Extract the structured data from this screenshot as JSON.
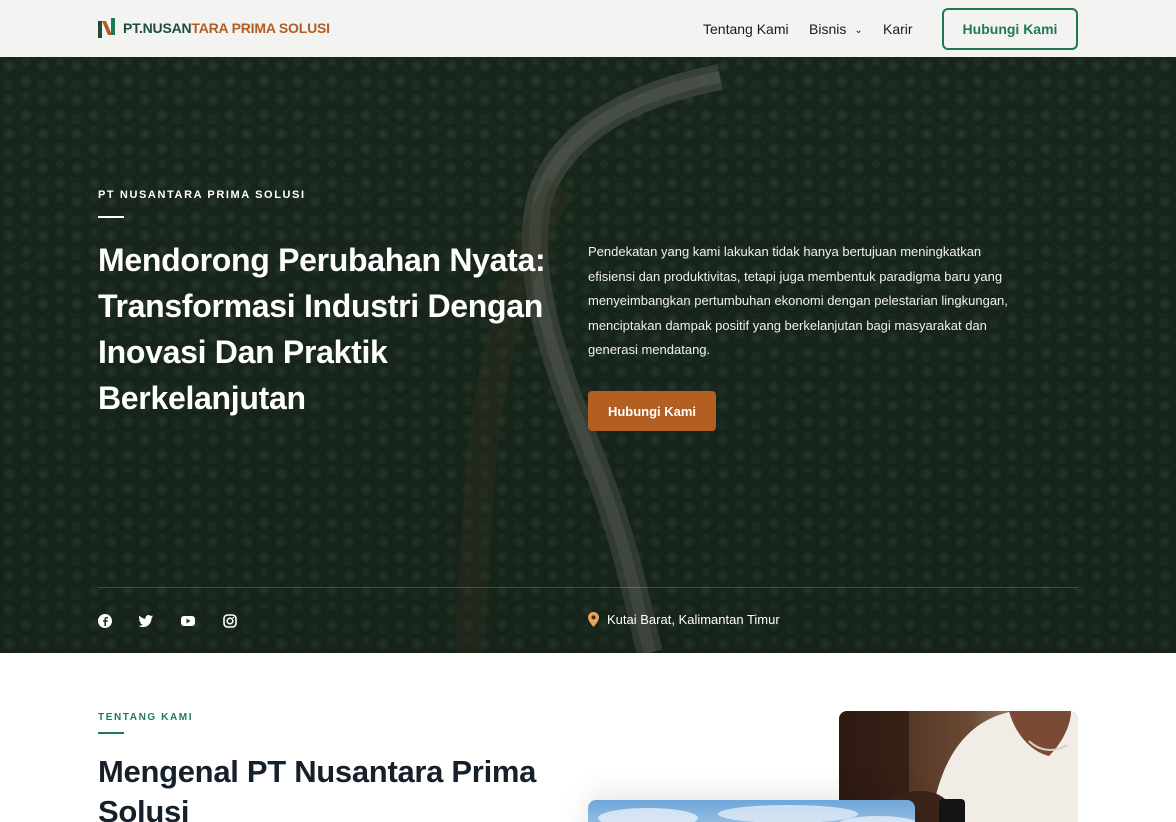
{
  "header": {
    "logo": {
      "part1": "PT.NUSAN",
      "part2": "TARA PRIMA SOLUSI",
      "colors": {
        "green": "#1d4d3b",
        "brown": "#b05d22"
      }
    },
    "nav": [
      {
        "label": "Tentang Kami"
      },
      {
        "label": "Bisnis",
        "has_dropdown": true
      },
      {
        "label": "Karir"
      }
    ],
    "cta_label": "Hubungi Kami"
  },
  "hero": {
    "eyebrow": "PT NUSANTARA PRIMA SOLUSI",
    "title": "Mendorong Perubahan Nyata: Transformasi Industri Dengan Inovasi Dan Praktik Berkelanjutan",
    "description": "Pendekatan yang kami lakukan tidak hanya bertujuan meningkatkan efisiensi dan produktivitas, tetapi juga membentuk paradigma baru yang menyeimbangkan pertumbuhan ekonomi dengan pelestarian lingkungan, menciptakan dampak positif yang berkelanjutan bagi masyarakat dan generasi mendatang.",
    "cta_label": "Hubungi Kami",
    "social_icons": [
      "facebook-icon",
      "twitter-icon",
      "youtube-icon",
      "instagram-icon"
    ],
    "location": "Kutai Barat, Kalimantan Timur",
    "colors": {
      "accent": "#b35f22",
      "pin": "#e6a35c"
    }
  },
  "about": {
    "eyebrow": "TENTANG KAMI",
    "title": "Mengenal PT Nusantara Prima Solusi",
    "colors": {
      "accent": "#1f7a52",
      "title": "#15202b"
    }
  }
}
